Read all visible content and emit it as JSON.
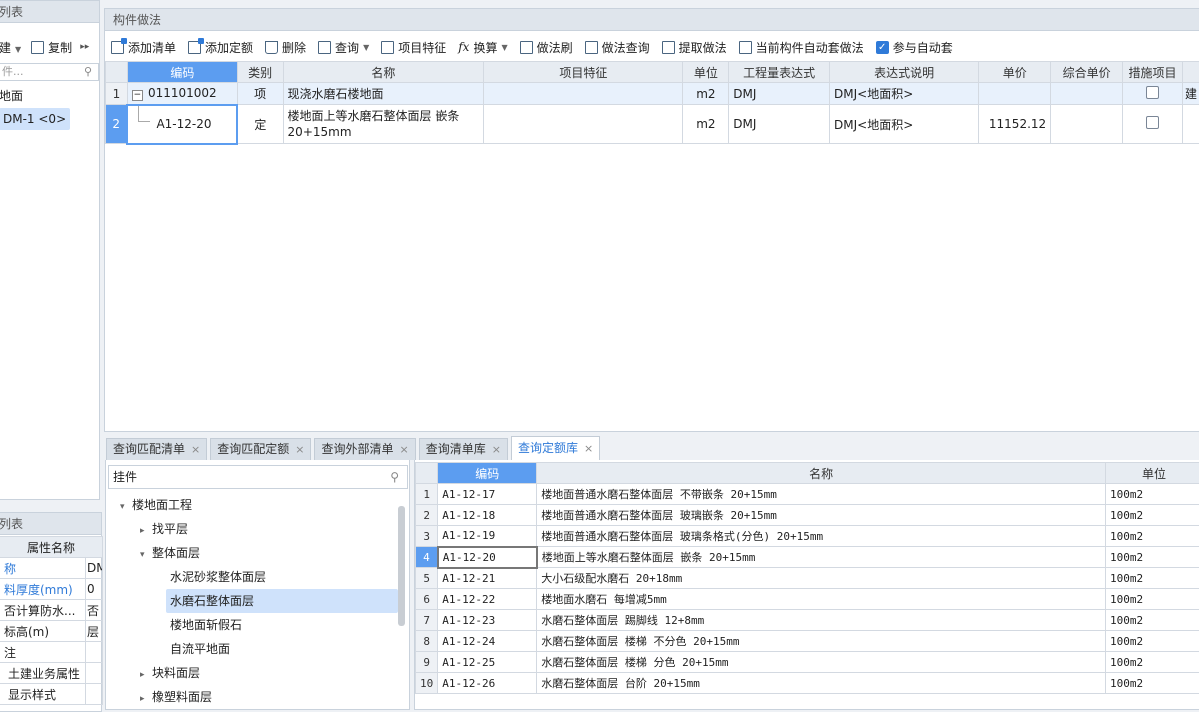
{
  "left_panel": {
    "title": "列表",
    "new_label": "建",
    "copy_label": "复制",
    "search_placeholder": "件...",
    "tree_root": "地面",
    "tree_item": "DM-1 <0>"
  },
  "props_panel": {
    "title": "列表",
    "header": "属性名称",
    "rows": [
      {
        "name": "称",
        "value": "DM"
      },
      {
        "name": "料厚度(mm)",
        "value": "0"
      },
      {
        "name": "否计算防水...",
        "value": "否"
      },
      {
        "name": "标高(m)",
        "value": "层"
      },
      {
        "name": "注",
        "value": ""
      },
      {
        "name": "土建业务属性",
        "value": ""
      },
      {
        "name": "显示样式",
        "value": ""
      }
    ]
  },
  "main_panel": {
    "title": "构件做法",
    "toolbar": {
      "add_list": "添加清单",
      "add_quota": "添加定额",
      "delete": "删除",
      "query": "查询",
      "item_feature": "项目特征",
      "convert": "换算",
      "method_brush": "做法刷",
      "method_query": "做法查询",
      "extract": "提取做法",
      "auto_apply": "当前构件自动套做法",
      "participate": "参与自动套"
    },
    "columns": [
      "编码",
      "类别",
      "名称",
      "项目特征",
      "单位",
      "工程量表达式",
      "表达式说明",
      "单价",
      "综合单价",
      "措施项目"
    ],
    "rows": [
      {
        "no": "1",
        "code": "011101002",
        "type": "项",
        "name": "现浇水磨石楼地面",
        "feature": "",
        "unit": "m2",
        "expr": "DMJ",
        "desc": "DMJ<地面积>",
        "price": "",
        "total": "",
        "extra": "建"
      },
      {
        "no": "2",
        "code": "A1-12-20",
        "type": "定",
        "name1": "楼地面上等水磨石整体面层 嵌条",
        "name2": "20+15mm",
        "feature": "",
        "unit": "m2",
        "expr": "DMJ",
        "desc": "DMJ<地面积>",
        "price": "11152.12",
        "total": "",
        "extra": ""
      }
    ]
  },
  "bottom": {
    "tabs": [
      "查询匹配清单",
      "查询匹配定额",
      "查询外部清单",
      "查询清单库",
      "查询定额库"
    ],
    "search_value": "挂件",
    "tree": [
      "楼地面工程",
      "找平层",
      "整体面层",
      "水泥砂浆整体面层",
      "水磨石整体面层",
      "楼地面斩假石",
      "自流平地面",
      "块料面层",
      "橡塑料面层"
    ],
    "columns": [
      "编码",
      "名称",
      "单位"
    ],
    "rows": [
      {
        "no": "1",
        "code": "A1-12-17",
        "name": "楼地面普通水磨石整体面层 不带嵌条 20+15mm",
        "unit": "100m2"
      },
      {
        "no": "2",
        "code": "A1-12-18",
        "name": "楼地面普通水磨石整体面层 玻璃嵌条 20+15mm",
        "unit": "100m2"
      },
      {
        "no": "3",
        "code": "A1-12-19",
        "name": "楼地面普通水磨石整体面层 玻璃条格式(分色) 20+15mm",
        "unit": "100m2"
      },
      {
        "no": "4",
        "code": "A1-12-20",
        "name": "楼地面上等水磨石整体面层 嵌条 20+15mm",
        "unit": "100m2"
      },
      {
        "no": "5",
        "code": "A1-12-21",
        "name": "大小石级配水磨石 20+18mm",
        "unit": "100m2"
      },
      {
        "no": "6",
        "code": "A1-12-22",
        "name": "楼地面水磨石 每增减5mm",
        "unit": "100m2"
      },
      {
        "no": "7",
        "code": "A1-12-23",
        "name": "水磨石整体面层 踢脚线 12+8mm",
        "unit": "100m2"
      },
      {
        "no": "8",
        "code": "A1-12-24",
        "name": "水磨石整体面层 楼梯 不分色 20+15mm",
        "unit": "100m2"
      },
      {
        "no": "9",
        "code": "A1-12-25",
        "name": "水磨石整体面层 楼梯 分色 20+15mm",
        "unit": "100m2"
      },
      {
        "no": "10",
        "code": "A1-12-26",
        "name": "水磨石整体面层 台阶 20+15mm",
        "unit": "100m2"
      }
    ]
  },
  "colors": {
    "accent": "#2f7ad8",
    "header_selected": "#5c9df0",
    "row_selected": "#cfe2fb"
  }
}
